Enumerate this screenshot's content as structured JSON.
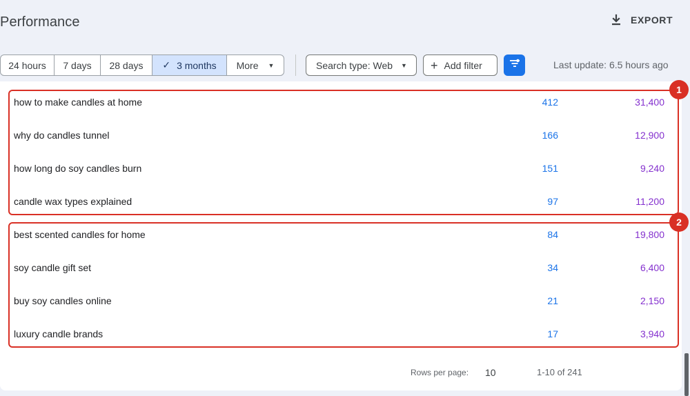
{
  "header": {
    "title": "Performance",
    "export_label": "EXPORT",
    "export_icon": "download-icon"
  },
  "toolbar": {
    "date_ranges": [
      {
        "label": "24 hours",
        "active": false
      },
      {
        "label": "7 days",
        "active": false
      },
      {
        "label": "28 days",
        "active": false
      },
      {
        "label": "3 months",
        "active": true
      },
      {
        "label": "More",
        "active": false
      }
    ],
    "search_type_label": "Search type: Web",
    "add_filter_label": "Add filter",
    "filter_icon": "filter-list-icon",
    "last_update": "Last update: 6.5 hours ago"
  },
  "table": {
    "rows": [
      {
        "query": "how to make candles at home",
        "clicks": "412",
        "impressions": "31,400"
      },
      {
        "query": "why do candles tunnel",
        "clicks": "166",
        "impressions": "12,900"
      },
      {
        "query": "how long do soy candles burn",
        "clicks": "151",
        "impressions": "9,240"
      },
      {
        "query": "candle wax types explained",
        "clicks": "97",
        "impressions": "11,200"
      },
      {
        "query": "best scented candles for home",
        "clicks": "84",
        "impressions": "19,800"
      },
      {
        "query": "soy candle gift set",
        "clicks": "34",
        "impressions": "6,400"
      },
      {
        "query": "buy soy candles online",
        "clicks": "21",
        "impressions": "2,150"
      },
      {
        "query": "luxury candle brands",
        "clicks": "17",
        "impressions": "3,940"
      }
    ]
  },
  "annotations": [
    {
      "label": "1",
      "color": "#d93025"
    },
    {
      "label": "2",
      "color": "#d93025"
    }
  ],
  "pagination": {
    "rows_per_page_label": "Rows per page:",
    "rows_per_page_value": "10",
    "range": "1-10 of 241"
  },
  "colors": {
    "accent": "#1a73e8",
    "clicks": "#1a73e8",
    "impressions": "#8430ce",
    "active_segment": "#d3e3fd"
  }
}
